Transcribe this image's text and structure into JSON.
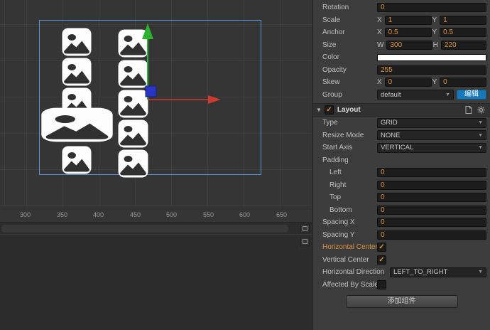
{
  "colors": {
    "accent_orange": "#e2913c",
    "selection_blue": "#5596d8",
    "gizmo_green": "#2db32d",
    "gizmo_red": "#cc3a2e",
    "gizmo_blue": "#2a35c8",
    "edit_button_blue": "#1878b8",
    "sprite_fill": "#ffffff"
  },
  "scene": {
    "ruler_labels": [
      "300",
      "350",
      "400",
      "450",
      "500",
      "550",
      "600",
      "650"
    ]
  },
  "inspector": {
    "rotation": {
      "label": "Rotation",
      "value": "0"
    },
    "scale": {
      "label": "Scale",
      "x_label": "X",
      "x": "1",
      "y_label": "Y",
      "y": "1"
    },
    "anchor": {
      "label": "Anchor",
      "x_label": "X",
      "x": "0.5",
      "y_label": "Y",
      "y": "0.5"
    },
    "size": {
      "label": "Size",
      "w_label": "W",
      "w": "300",
      "h_label": "H",
      "h": "220"
    },
    "color": {
      "label": "Color",
      "value": "#FFFFFF"
    },
    "opacity": {
      "label": "Opacity",
      "value": "255"
    },
    "skew": {
      "label": "Skew",
      "x_label": "X",
      "x": "0",
      "y_label": "Y",
      "y": "0"
    },
    "group": {
      "label": "Group",
      "value": "default",
      "edit_label": "编辑"
    },
    "layout": {
      "title": "Layout",
      "enabled_check": "✓",
      "type": {
        "label": "Type",
        "value": "GRID"
      },
      "resize_mode": {
        "label": "Resize Mode",
        "value": "NONE"
      },
      "start_axis": {
        "label": "Start Axis",
        "value": "VERTICAL"
      },
      "padding_label": "Padding",
      "padding_left": {
        "label": "Left",
        "value": "0"
      },
      "padding_right": {
        "label": "Right",
        "value": "0"
      },
      "padding_top": {
        "label": "Top",
        "value": "0"
      },
      "padding_bottom": {
        "label": "Bottom",
        "value": "0"
      },
      "spacing_x": {
        "label": "Spacing X",
        "value": "0"
      },
      "spacing_y": {
        "label": "Spacing Y",
        "value": "0"
      },
      "horizontal_center": {
        "label": "Horizontal Center",
        "checked": true,
        "check": "✓"
      },
      "vertical_center": {
        "label": "Vertical Center",
        "checked": true,
        "check": "✓"
      },
      "horizontal_direction": {
        "label": "Horizontal Direction",
        "value": "LEFT_TO_RIGHT"
      },
      "affected_by_scale": {
        "label": "Affected By Scale",
        "checked": false,
        "check": ""
      }
    },
    "add_component_label": "添加组件"
  }
}
